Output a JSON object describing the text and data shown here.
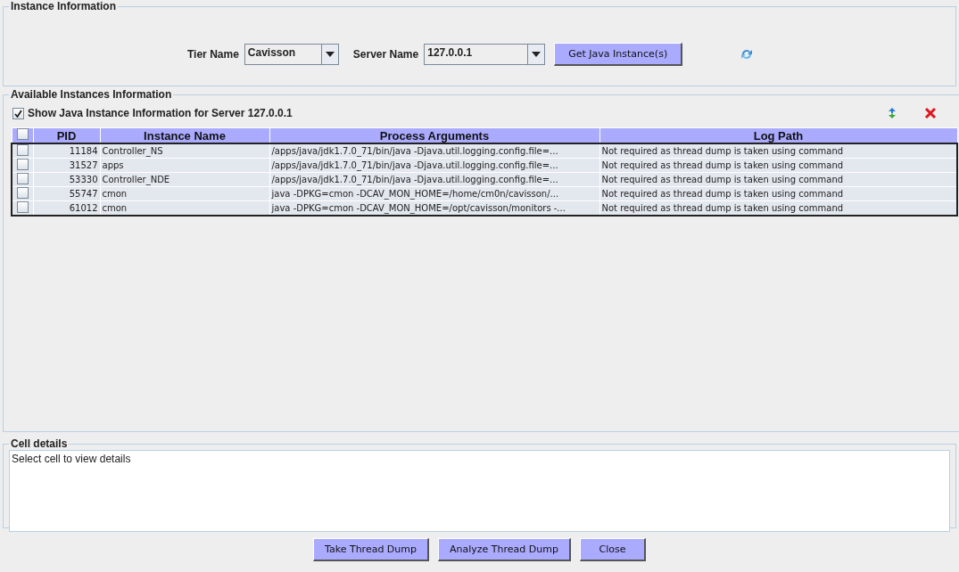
{
  "instance_information": {
    "title": "Instance Information",
    "tier_name": {
      "label": "Tier Name",
      "value": "Cavisson"
    },
    "server_name": {
      "label": "Server Name",
      "value": "127.0.0.1"
    },
    "get_button": "Get Java Instance(s)"
  },
  "available_instances": {
    "title": "Available Instances Information",
    "show_checkbox": {
      "label": "Show Java Instance Information for Server 127.0.0.1",
      "checked": true
    },
    "table": {
      "header_checked": false,
      "columns": [
        "PID",
        "Instance Name",
        "Process Arguments",
        "Log Path"
      ],
      "rows": [
        {
          "checked": false,
          "cells": [
            "11184",
            "Controller_NS",
            "/apps/java/jdk1.7.0_71/bin/java -Djava.util.logging.config.file=...",
            "Not required as thread dump is taken using command"
          ]
        },
        {
          "checked": false,
          "cells": [
            "31527",
            "apps",
            "/apps/java/jdk1.7.0_71/bin/java -Djava.util.logging.config.file=...",
            "Not required as thread dump is taken using command"
          ]
        },
        {
          "checked": false,
          "cells": [
            "53330",
            "Controller_NDE",
            "/apps/java/jdk1.7.0_71/bin/java -Djava.util.logging.config.file=...",
            "Not required as thread dump is taken using command"
          ]
        },
        {
          "checked": false,
          "cells": [
            "55747",
            "cmon",
            "java -DPKG=cmon -DCAV_MON_HOME=/home/cm0n/cavisson/...",
            "Not required as thread dump is taken using command"
          ]
        },
        {
          "checked": false,
          "cells": [
            "61012",
            "cmon",
            "java -DPKG=cmon -DCAV_MON_HOME=/opt/cavisson/monitors -...",
            "Not required as thread dump is taken using command"
          ]
        }
      ]
    }
  },
  "cell_details": {
    "title": "Cell details",
    "text": "Select cell to view details"
  },
  "buttons": [
    "Take Thread Dump",
    "Analyze Thread Dump",
    "Close"
  ]
}
